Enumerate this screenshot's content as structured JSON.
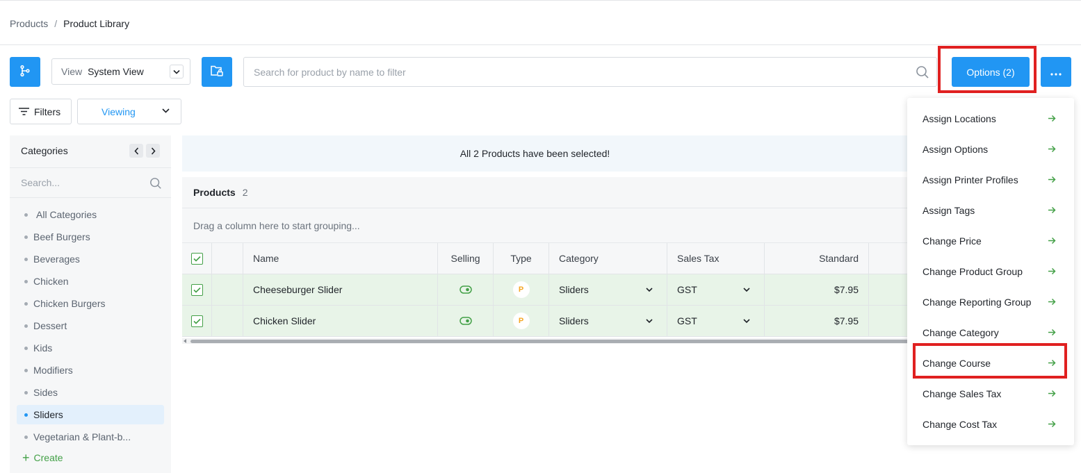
{
  "breadcrumb": {
    "parent": "Products",
    "separator": "/",
    "current": "Product Library"
  },
  "toolbar": {
    "view_label": "View",
    "view_value": "System View",
    "search_placeholder": "Search for product by name to filter",
    "options_label": "Options (2)",
    "filters_label": "Filters",
    "viewing_label": "Viewing"
  },
  "categories": {
    "title": "Categories",
    "search_placeholder": "Search...",
    "items": [
      {
        "label": "All Categories"
      },
      {
        "label": "Beef Burgers"
      },
      {
        "label": "Beverages"
      },
      {
        "label": "Chicken"
      },
      {
        "label": "Chicken Burgers"
      },
      {
        "label": "Dessert"
      },
      {
        "label": "Kids"
      },
      {
        "label": "Modifiers"
      },
      {
        "label": "Sides"
      },
      {
        "label": "Sliders"
      },
      {
        "label": "Vegetarian & Plant-b..."
      }
    ],
    "active_item": "Sliders",
    "create_label": "Create"
  },
  "banner": {
    "text": "All 2 Products have been selected!"
  },
  "grid": {
    "title": "Products",
    "count": "2",
    "group_hint": "Drag a column here to start grouping...",
    "columns": {
      "name": "Name",
      "selling": "Selling",
      "type": "Type",
      "category": "Category",
      "sales_tax": "Sales Tax",
      "standard": "Standard"
    },
    "rows": [
      {
        "name": "Cheeseburger Slider",
        "type": "P",
        "category": "Sliders",
        "sales_tax": "GST",
        "standard": "$7.95",
        "selling": true,
        "selected": true
      },
      {
        "name": "Chicken Slider",
        "type": "P",
        "category": "Sliders",
        "sales_tax": "GST",
        "standard": "$7.95",
        "selling": true,
        "selected": true
      }
    ]
  },
  "options_menu": {
    "items": [
      {
        "label": "Assign Locations"
      },
      {
        "label": "Assign Options"
      },
      {
        "label": "Assign Printer Profiles"
      },
      {
        "label": "Assign Tags"
      },
      {
        "label": "Change Price"
      },
      {
        "label": "Change Product Group"
      },
      {
        "label": "Change Reporting Group"
      },
      {
        "label": "Change Category"
      },
      {
        "label": "Change Course"
      },
      {
        "label": "Change Sales Tax"
      },
      {
        "label": "Change Cost Tax"
      }
    ],
    "highlighted_item": "Change Course"
  },
  "colors": {
    "accent": "#2196f3",
    "success": "#43a047",
    "highlight_box": "#e02020",
    "selected_row": "#e8f4e8",
    "type_badge": "#f5a623"
  },
  "icons": [
    "branch-icon",
    "chevron-down-icon",
    "folder-lock-icon",
    "search-icon",
    "ellipsis-icon",
    "filter-icon",
    "chevron-left-icon",
    "chevron-right-icon",
    "plus-icon",
    "checkbox-icon",
    "toggle-icon",
    "arrow-right-icon"
  ]
}
